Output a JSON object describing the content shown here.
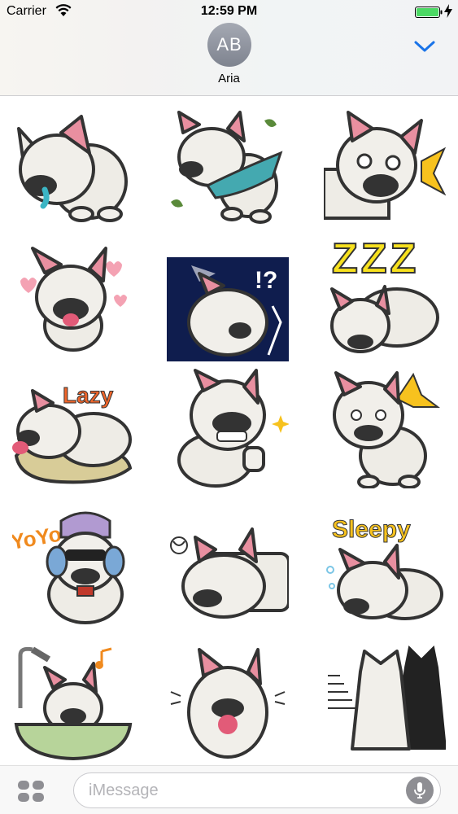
{
  "status_bar": {
    "carrier": "Carrier",
    "time": "12:59 PM",
    "battery_level": 1.0,
    "battery_color": "#4cd964"
  },
  "header": {
    "avatar_initials": "AB",
    "contact_name": "Aria",
    "accent_color": "#1a73e8"
  },
  "stickers": [
    {
      "id": "crying-bulldog"
    },
    {
      "id": "windy-scarf-bulldog"
    },
    {
      "id": "shocked-bulldog"
    },
    {
      "id": "hearts-bulldog"
    },
    {
      "id": "surprised-lightning-bulldog",
      "caption": "!?"
    },
    {
      "id": "sleeping-zzz-bulldog",
      "caption": "ZZZ"
    },
    {
      "id": "lazy-pillow-bulldog",
      "caption": "Lazy"
    },
    {
      "id": "thumbs-up-bulldog"
    },
    {
      "id": "annoyed-bulldog"
    },
    {
      "id": "yoyo-headphones-bulldog",
      "caption": "YoYo"
    },
    {
      "id": "lying-down-bulldog"
    },
    {
      "id": "sleepy-bulldog",
      "caption": "Sleepy"
    },
    {
      "id": "bath-bulldog"
    },
    {
      "id": "happy-tongue-bulldog"
    },
    {
      "id": "shadow-bulldog"
    }
  ],
  "input_bar": {
    "placeholder": "iMessage"
  }
}
